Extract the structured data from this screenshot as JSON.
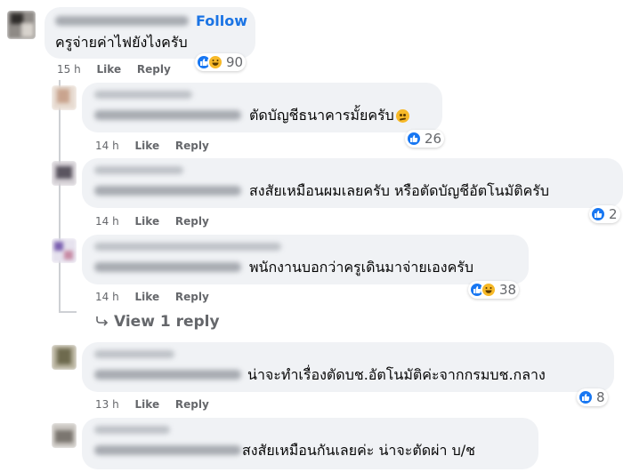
{
  "accent": "#1b74e4",
  "reaction_like_color": "#1877f2",
  "reaction_haha_color": "#f7b928",
  "labels": {
    "follow": "Follow",
    "like": "Like",
    "reply": "Reply",
    "view_replies": "View 1 reply"
  },
  "main_comment": {
    "text": "ครูจ่ายค่าไฟยังไงครับ",
    "time": "15 h",
    "reactions": "90"
  },
  "replies": [
    {
      "text": "ตัดบัญชีธนาคารมั้ยครับ",
      "time": "14 h",
      "reactions": "26",
      "reaction_icons": [
        "like-icon"
      ],
      "trailing_emoji": "thinking-emoji"
    },
    {
      "text": "สงสัยเหมือนผมเลยครับ หรือตัดบัญชีอัตโนมัติครับ",
      "time": "14 h",
      "reactions": "2",
      "reaction_icons": [
        "like-icon"
      ]
    },
    {
      "text": "พนักงานบอกว่าครูเดินมาจ่ายเองครับ",
      "time": "14 h",
      "reactions": "38",
      "reaction_icons": [
        "like-icon",
        "haha-icon"
      ]
    }
  ],
  "more_comments": [
    {
      "text": "น่าจะทำเรื่องตัดบช.อัตโนมัติค่ะจากกรมบช.กลาง",
      "time": "13 h",
      "reactions": "8",
      "reaction_icons": [
        "like-icon"
      ]
    },
    {
      "text": "สงสัยเหมือนกันเลยค่ะ น่าจะตัดผ่า บ/ช"
    }
  ]
}
